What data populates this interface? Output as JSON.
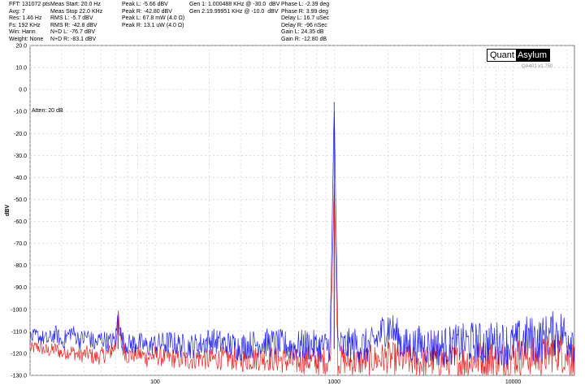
{
  "stats": {
    "col1": [
      "FFT: 131072 pts",
      "Avg: 7",
      "Res: 1.46 Hz",
      "Fs: 192 KHz",
      "Win: Hann",
      "Weight: None"
    ],
    "col2": [
      "Meas Start: 20.0 Hz",
      "Meas Stop 22.0 KHz",
      "RMS L: -5.7 dBV",
      "RMS R: -42.8 dBV",
      "N+D L: -76.7 dBV",
      "N+D R: -83.1 dBV"
    ],
    "col3": [
      "Peak L: -5.66 dBV",
      "Peak R: -42.80 dBV",
      "Peak L: 67.8 mW (4.0 Ω)",
      "Peak R: 13.1 uW (4.0 Ω)"
    ],
    "col4": [
      "Gen 1: 1.000488 KHz @ -30.0  dBV",
      "Gen 2:19.99951 KHz @ -10.0  dBV"
    ],
    "col5": [
      "Phase L: -2.39 deg",
      "Phase R: 3.99 deg",
      "Delay L: 16.7 uSec",
      "Delay R: -96 nSec",
      "Gain L: 24.35 dB",
      "Gain R: -12.80 dB"
    ]
  },
  "logo": {
    "part1": "Quant",
    "part2": "Asylum"
  },
  "version": "QA401 v1.750",
  "annotation": "Atten: 20 dB",
  "colors": {
    "left": "#1010ee",
    "right": "#ee1010",
    "grid": "#c8c8c8"
  },
  "chart_data": {
    "type": "line",
    "x_scale": "log",
    "xlim": [
      20,
      22000
    ],
    "ylim": [
      -130,
      20
    ],
    "ylabel": "dBV",
    "xticks": [
      100,
      1000,
      10000
    ],
    "xtick_labels": [
      "100",
      "1000",
      "10000"
    ],
    "yticks": [
      20,
      10,
      0,
      -10,
      -20,
      -30,
      -40,
      -50,
      -60,
      -70,
      -80,
      -90,
      -100,
      -110,
      -120,
      -130
    ],
    "ytick_labels": [
      "20.0",
      "10.0",
      "0.0",
      "-10.0",
      "-20.0",
      "-30.0",
      "-40.0",
      "-50.0",
      "-60.0",
      "-70.0",
      "-80.0",
      "-90.0",
      "-100.0",
      "-110.0",
      "-120.0",
      "-130.0"
    ],
    "grid": true,
    "series": [
      {
        "name": "L",
        "color": "#1010ee",
        "x": [
          20,
          22,
          25,
          28,
          30,
          34,
          38,
          42,
          46,
          50,
          55,
          60,
          62,
          65,
          70,
          80,
          90,
          100,
          120,
          150,
          180,
          200,
          250,
          300,
          400,
          500,
          600,
          700,
          800,
          900,
          950,
          1000,
          1050,
          1100,
          1300,
          1600,
          2000,
          2500,
          3000,
          4000,
          5000,
          6000,
          7000,
          8000,
          10000,
          12000,
          14000,
          16000,
          18000,
          20000,
          22000
        ],
        "y": [
          -113,
          -112,
          -114,
          -111,
          -115,
          -110,
          -114,
          -112,
          -116,
          -113,
          -115,
          -114,
          -103,
          -114,
          -116,
          -115,
          -117,
          -116,
          -115,
          -117,
          -116,
          -114,
          -116,
          -117,
          -115,
          -116,
          -117,
          -116,
          -117,
          -117,
          -116,
          -5.66,
          -116,
          -117,
          -116,
          -117,
          -107,
          -117,
          -116,
          -117,
          -116,
          -115,
          -116,
          -115,
          -116,
          -113,
          -114,
          -112,
          -110,
          -112,
          -113
        ],
        "noise": 3.5
      },
      {
        "name": "R",
        "color": "#ee1010",
        "x": [
          20,
          22,
          25,
          28,
          30,
          34,
          38,
          42,
          46,
          50,
          55,
          60,
          62,
          65,
          70,
          80,
          90,
          100,
          120,
          150,
          180,
          200,
          250,
          300,
          400,
          500,
          600,
          700,
          800,
          900,
          950,
          1000,
          1050,
          1100,
          1300,
          1600,
          2000,
          2500,
          3000,
          4000,
          5000,
          6000,
          7000,
          8000,
          10000,
          12000,
          14000,
          16000,
          18000,
          20000,
          22000
        ],
        "y": [
          -118,
          -117,
          -119,
          -118,
          -120,
          -119,
          -121,
          -120,
          -122,
          -121,
          -120,
          -117,
          -103,
          -117,
          -121,
          -120,
          -122,
          -121,
          -122,
          -123,
          -122,
          -123,
          -122,
          -123,
          -122,
          -123,
          -124,
          -123,
          -124,
          -123,
          -124,
          -42.8,
          -124,
          -123,
          -124,
          -123,
          -122,
          -123,
          -124,
          -123,
          -124,
          -123,
          -122,
          -123,
          -122,
          -121,
          -122,
          -120,
          -119,
          -121,
          -124
        ],
        "noise": 3.0
      }
    ]
  }
}
